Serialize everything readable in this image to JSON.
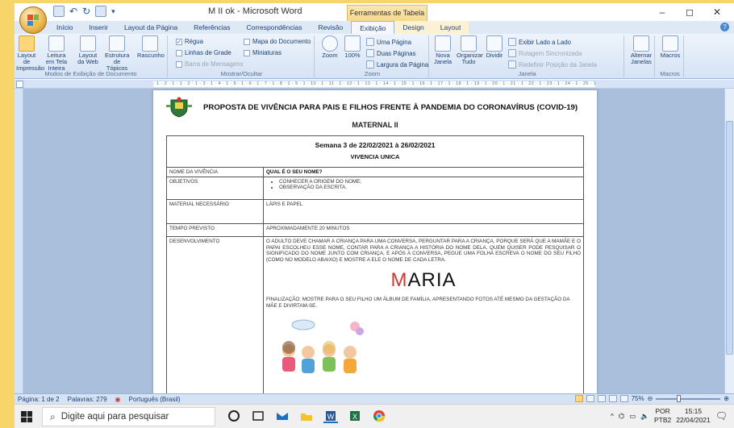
{
  "window": {
    "title": "M II ok - Microsoft Word",
    "context_tab": "Ferramentas de Tabela",
    "controls": [
      "–",
      "◻",
      "✕"
    ]
  },
  "tabs": [
    {
      "label": "Início"
    },
    {
      "label": "Inserir"
    },
    {
      "label": "Layout da Página"
    },
    {
      "label": "Referências"
    },
    {
      "label": "Correspondências"
    },
    {
      "label": "Revisão"
    },
    {
      "label": "Exibição",
      "active": true
    },
    {
      "label": "Design",
      "context": true
    },
    {
      "label": "Layout",
      "context": true
    }
  ],
  "ribbon": {
    "views_group": {
      "label": "Modos de Exibição de Documento",
      "buttons": [
        "Layout de Impressão",
        "Leitura em Tela Inteira",
        "Layout da Web",
        "Estrutura de Tópicos",
        "Rascunho"
      ]
    },
    "show_group": {
      "label": "Mostrar/Ocultar",
      "items": [
        {
          "label": "Régua",
          "checked": true
        },
        {
          "label": "Linhas de Grade",
          "checked": false
        },
        {
          "label": "Barra de Mensagens",
          "checked": false,
          "disabled": true
        },
        {
          "label": "Mapa do Documento",
          "checked": false
        },
        {
          "label": "Miniaturas",
          "checked": false
        }
      ]
    },
    "zoom_group": {
      "label": "Zoom",
      "zoom_label": "Zoom",
      "pct_label": "100%",
      "items": [
        "Uma Página",
        "Duas Páginas",
        "Largura da Página"
      ]
    },
    "window_group": {
      "label": "Janela",
      "buttons": [
        "Nova Janela",
        "Organizar Tudo",
        "Dividir"
      ],
      "items": [
        "Exibir Lado a Lado",
        "Rolagem Sincronizada",
        "Redefinir Posição da Janela"
      ],
      "switch_label": "Alternar Janelas"
    },
    "macros_group": {
      "label": "Macros",
      "button": "Macros"
    }
  },
  "document": {
    "title": "PROPOSTA DE VIVÊNCIA PARA PAIS E FILHOS FRENTE À PANDEMIA DO CORONAVÍRUS (COVID-19)",
    "subtitle": "MATERNAL II",
    "week": "Semana 3 de 22/02/2021 à 26/02/2021",
    "vivencia_header": "VIVENCIA UNICA",
    "rows": [
      {
        "label": "NOME DA VIVÊNCIA",
        "value": "QUAL É O SEU NOME?"
      },
      {
        "label": "OBJETIVOS",
        "bullets": [
          "CONHECER A ORIGEM DO NOME;",
          "OBSERVAÇÃO DA ESCRITA."
        ]
      },
      {
        "label": "MATERIAL NECESSÁRIO",
        "value": "LÁPIS E PAPEL"
      },
      {
        "label": "TEMPO PREVISTO",
        "value": "APROXIMADAMENTE 20 MINUTOS"
      },
      {
        "label": "DESENVOLVIMENTO",
        "value": "O ADULTO DEVE CHAMAR A CRIANÇA PARA UMA CONVERSA, PERGUNTAR PARA A CRIANÇA, PORQUE SERÁ QUE A MAMÃE E O PAPAI ESCOLHEU ESSE NOME, CONTAR PARA A CRIANÇA A HISTÓRIA DO NOME DELA. QUEM QUISER PODE PESQUISAR O SIGNIFICADO DO NOME JUNTO COM CRIANÇA, E APÓS A CONVERSA, PEGUE UMA FOLHA ESCREVA O NOME DO SEU FILHO (COMO NO MODELO ABAIXO) E MOSTRE A ELE O NOME DE CADA LETRA."
      }
    ],
    "name_example_first": "M",
    "name_example_rest": "ARIA",
    "finalization": "FINALIZAÇÃO: MOSTRE PARA O SEU FILHO UM ÁLBUM DE FAMÍLIA, APRESENTANDO FOTOS ATÉ MESMO DA GESTAÇÃO DA MÃE E DIVIRTAM-SE."
  },
  "status": {
    "page": "Página: 1 de 2",
    "words": "Palavras: 279",
    "language": "Português (Brasil)",
    "zoom": "75%"
  },
  "taskbar": {
    "search_placeholder": "Digite aqui para pesquisar",
    "lang_top": "POR",
    "lang_bottom": "PTB2",
    "time": "15:15",
    "date": "22/04/2021"
  },
  "colors": {
    "border_frame": "#f7d56a",
    "ribbon": "#d5e3f5",
    "doc_bg": "#a9bfdc",
    "maria_accent": "#d8312c"
  }
}
